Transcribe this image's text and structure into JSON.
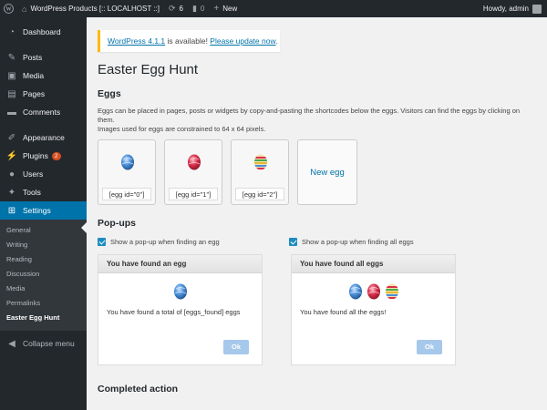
{
  "adminbar": {
    "site_name": "WordPress Products [:: LOCALHOST ::]",
    "updates_count": "6",
    "comments_count": "0",
    "new_label": "New",
    "howdy": "Howdy, admin"
  },
  "sidebar": {
    "items": [
      {
        "label": "Dashboard",
        "icon": "dashboard-icon"
      },
      {
        "label": "Posts",
        "icon": "pin-icon"
      },
      {
        "label": "Media",
        "icon": "media-icon"
      },
      {
        "label": "Pages",
        "icon": "pages-icon"
      },
      {
        "label": "Comments",
        "icon": "comments-icon"
      },
      {
        "label": "Appearance",
        "icon": "brush-icon"
      },
      {
        "label": "Plugins",
        "icon": "plug-icon",
        "badge": "2"
      },
      {
        "label": "Users",
        "icon": "user-icon"
      },
      {
        "label": "Tools",
        "icon": "wrench-icon"
      },
      {
        "label": "Settings",
        "icon": "settings-icon"
      }
    ],
    "submenu": [
      "General",
      "Writing",
      "Reading",
      "Discussion",
      "Media",
      "Permalinks",
      "Easter Egg Hunt"
    ],
    "collapse": "Collapse menu"
  },
  "notice": {
    "version_link": "WordPress 4.1.1",
    "text": " is available! ",
    "update_link": "Please update now",
    "end": "."
  },
  "page": {
    "title": "Easter Egg Hunt",
    "eggs_heading": "Eggs",
    "eggs_desc_1": "Eggs can be placed in pages, posts or widgets by copy-and-pasting the shortcodes below the eggs. Visitors can find the eggs by clicking on them.",
    "eggs_desc_2": "Images used for eggs are constrained to 64 x 64 pixels.",
    "eggs": [
      {
        "code": "[egg id=\"0\"]"
      },
      {
        "code": "[egg id=\"1\"]"
      },
      {
        "code": "[egg id=\"2\"]"
      }
    ],
    "new_egg": "New egg",
    "popups_heading": "Pop-ups",
    "check_found_egg": "Show a pop-up when finding an egg",
    "check_found_all": "Show a pop-up when finding all eggs",
    "popup1": {
      "title": "You have found an egg",
      "message": "You have found a total of [eggs_found] eggs",
      "ok": "Ok"
    },
    "popup2": {
      "title": "You have found all eggs",
      "message": "You have found all the eggs!",
      "ok": "Ok"
    },
    "completed_heading": "Completed action"
  },
  "colors": {
    "adminbar_bg": "#23282d",
    "accent": "#0073aa",
    "notice_border": "#ffba00",
    "egg_blue": "#4a90d9",
    "egg_red": "#d9304b",
    "egg_striped": "#e8b830"
  }
}
